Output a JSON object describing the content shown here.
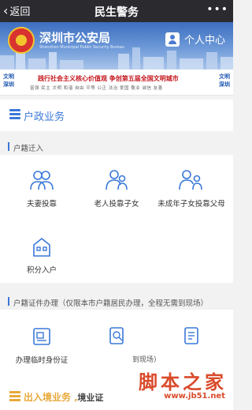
{
  "nav": {
    "back_label": "返回",
    "title": "民生警务",
    "more": "•••"
  },
  "banner": {
    "bureau_name": "深圳市公安局",
    "bureau_en": "Shenzhen Municipal Public Security Bureau",
    "user_center": "个人中心"
  },
  "civilization": {
    "left": "文明\n深圳",
    "right": "文明\n深圳",
    "headline": "践行社会主义核心价值观   争创第五届全国文明城市",
    "values": "富强 民主 文明 和谐 自由 平等 公正 法治 爱国 敬业 诚信 友善"
  },
  "household": {
    "section_title": "户政业务",
    "group1_title": "户籍迁入",
    "group1_items": [
      {
        "label": "夫妻投靠",
        "icon": "couple-icon"
      },
      {
        "label": "老人投靠子女",
        "icon": "elder-icon"
      },
      {
        "label": "未成年子女投靠父母",
        "icon": "child-icon"
      },
      {
        "label": "积分入户",
        "icon": "points-house-icon"
      }
    ],
    "group2_title": "户籍证件办理（仅限本市户籍居民办理，全程无需到现场）",
    "group2_items": [
      {
        "label": "办理临时身份证",
        "icon": "id-card-icon"
      }
    ],
    "partial_text": "到现场）"
  },
  "footer": {
    "section_title": "出入境业务",
    "partial_text": "境业证"
  },
  "watermark": {
    "text": "脚本之家",
    "url": "www.jb51.net"
  },
  "colors": {
    "nav_bg": "#2a2a2f",
    "accent": "#3a78d8",
    "orange": "#e8a93a",
    "red": "#c4171e"
  }
}
